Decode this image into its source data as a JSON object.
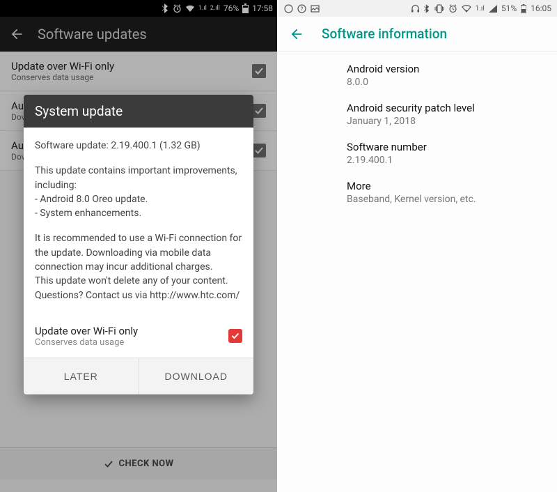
{
  "left": {
    "status": {
      "battery_pct": "76%",
      "time": "17:58",
      "carrier1": "1.ıl",
      "carrier2": "2.ıll"
    },
    "actionbar_title": "Software updates",
    "rows": [
      {
        "title": "Update over Wi-Fi only",
        "sub": "Conserves data usage"
      },
      {
        "title": "Au",
        "sub": "Dov"
      },
      {
        "title": "Au",
        "sub": "Dov"
      }
    ],
    "check_now": "CHECK NOW",
    "dialog": {
      "title": "System update",
      "version_line": "Software update: 2.19.400.1 (1.32 GB)",
      "intro": "This update contains important improvements, including:\n- Android 8.0 Oreo update.\n- System enhancements.",
      "wifi_notice": "It is recommended to use a Wi-Fi connection for the update. Downloading via mobile data connection may incur additional charges.\nThis update won't delete any of your content. Questions? Contact us via http://www.htc.com/",
      "option_title": "Update over Wi-Fi only",
      "option_sub": "Conserves data usage",
      "btn_later": "LATER",
      "btn_download": "DOWNLOAD"
    }
  },
  "right": {
    "status": {
      "battery_pct": "51%",
      "time": "16:05"
    },
    "actionbar_title": "Software information",
    "items": [
      {
        "title": "Android version",
        "value": "8.0.0"
      },
      {
        "title": "Android security patch level",
        "value": "January 1, 2018"
      },
      {
        "title": "Software number",
        "value": "2.19.400.1"
      },
      {
        "title": "More",
        "value": "Baseband, Kernel version, etc."
      }
    ]
  }
}
